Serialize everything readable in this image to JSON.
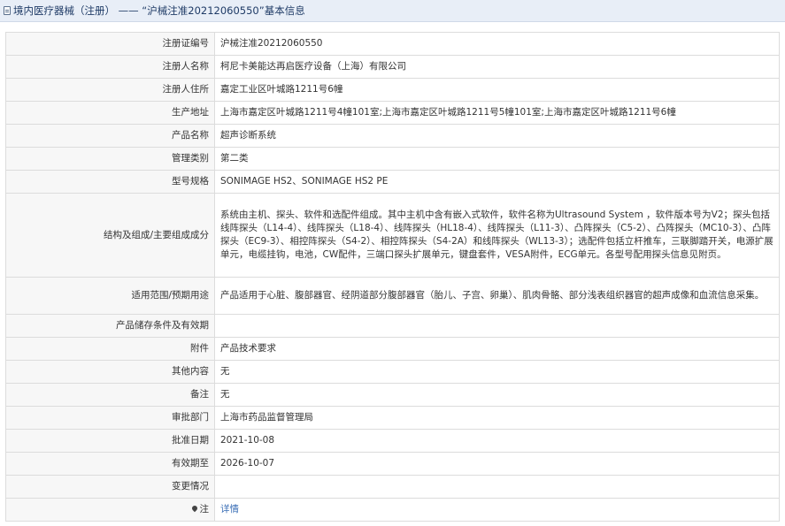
{
  "header": {
    "title": "境内医疗器械（注册） —— “沪械注准20212060550”基本信息"
  },
  "rows": [
    {
      "label": "注册证编号",
      "value": "沪械注准20212060550"
    },
    {
      "label": "注册人名称",
      "value": "柯尼卡美能达再启医疗设备（上海）有限公司"
    },
    {
      "label": "注册人住所",
      "value": "嘉定工业区叶城路1211号6幢"
    },
    {
      "label": "生产地址",
      "value": "上海市嘉定区叶城路1211号4幢101室;上海市嘉定区叶城路1211号5幢101室;上海市嘉定区叶城路1211号6幢"
    },
    {
      "label": "产品名称",
      "value": "超声诊断系统"
    },
    {
      "label": "管理类别",
      "value": "第二类"
    },
    {
      "label": "型号规格",
      "value": "SONIMAGE HS2、SONIMAGE HS2 PE"
    },
    {
      "label": "结构及组成/主要组成成分",
      "value": "系统由主机、探头、软件和选配件组成。其中主机中含有嵌入式软件，软件名称为Ultrasound System ，软件版本号为V2；探头包括线阵探头（L14-4）、线阵探头（L18-4）、线阵探头（HL18-4）、线阵探头（L11-3）、凸阵探头（C5-2）、凸阵探头（MC10-3）、凸阵探头（EC9-3）、相控阵探头（S4-2）、相控阵探头（S4-2A）和线阵探头（WL13-3）；选配件包括立杆推车，三联脚踏开关，电源扩展单元，电缆挂钩，电池，CW配件，三端口探头扩展单元，键盘套件，VESA附件，ECG单元。各型号配用探头信息见附页。"
    },
    {
      "label": "适用范围/预期用途",
      "value": "产品适用于心脏、腹部器官、经阴道部分腹部器官（胎儿、子宫、卵巢）、肌肉骨骼、部分浅表组织器官的超声成像和血流信息采集。"
    },
    {
      "label": "产品储存条件及有效期",
      "value": ""
    },
    {
      "label": "附件",
      "value": "产品技术要求"
    },
    {
      "label": "其他内容",
      "value": "无"
    },
    {
      "label": "备注",
      "value": "无"
    },
    {
      "label": "审批部门",
      "value": "上海市药品监督管理局"
    },
    {
      "label": "批准日期",
      "value": "2021-10-08"
    },
    {
      "label": "有效期至",
      "value": "2026-10-07"
    },
    {
      "label": "变更情况",
      "value": ""
    }
  ],
  "note_row": {
    "label": "注",
    "link_text": "详情"
  }
}
